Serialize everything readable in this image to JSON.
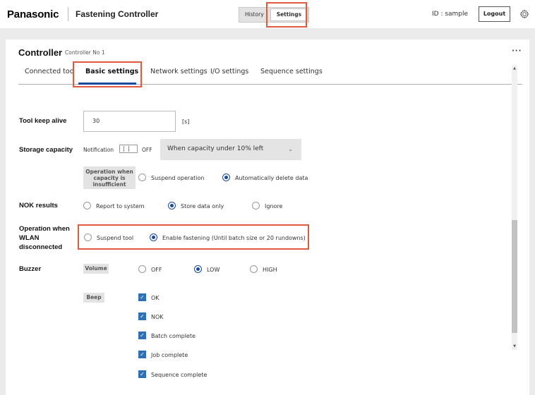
{
  "header": {
    "brand": "Panasonic",
    "app_title": "Fastening Controller",
    "nav": {
      "history": "History",
      "settings": "Settings"
    },
    "user_id": "ID : sample",
    "logout": "Logout"
  },
  "controller": {
    "title": "Controller",
    "subtitle": "Controller No 1",
    "more": "···",
    "tabs": [
      "Connected too",
      "Basic settings",
      "Network settings",
      "I/O settings",
      "Sequence settings"
    ]
  },
  "settings": {
    "tool_keep_alive": {
      "label": "Tool keep alive",
      "value": "30",
      "unit": "[s]"
    },
    "storage_capacity": {
      "label": "Storage capacity",
      "notification_label": "Notification",
      "toggle_state": "OFF",
      "dropdown_value": "When capacity under 10% left",
      "insufficient_label": "Operation when capacity is insufficient",
      "options": [
        "Suspend operation",
        "Automatically delete data"
      ],
      "selected": "Automatically delete data"
    },
    "nok_results": {
      "label": "NOK results",
      "options": [
        "Report to system",
        "Store data only",
        "Ignore"
      ],
      "selected": "Store data only"
    },
    "wlan": {
      "label": "Operation when WLAN disconnected",
      "options": [
        "Suspend tool",
        "Enable fastening (Until batch size or 20 rundowns)"
      ],
      "selected": "Enable fastening (Until batch size or 20 rundowns)"
    },
    "buzzer": {
      "label": "Buzzer",
      "volume_label": "Volume",
      "volume_options": [
        "OFF",
        "LOW",
        "HIGH"
      ],
      "volume_selected": "LOW",
      "beep_label": "Beep",
      "beep_options": [
        "OK",
        "NOK",
        "Batch complete",
        "Job complete",
        "Sequence complete"
      ],
      "beep_checked": [
        "OK",
        "NOK",
        "Batch complete",
        "Job complete",
        "Sequence complete"
      ]
    }
  },
  "colors": {
    "accent": "#1a4aa0",
    "highlight": "#e05a3f",
    "checkbox": "#2f6fb3"
  },
  "icons": {
    "settings": "gear-icon",
    "more": "more-icon",
    "dropdown": "chevron-down-icon"
  }
}
